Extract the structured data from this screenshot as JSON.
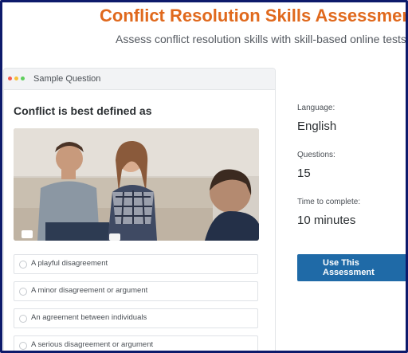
{
  "header": {
    "title": "Conflict Resolution Skills Assessment",
    "subtitle": "Assess conflict resolution skills with skill-based online tests"
  },
  "sample_card": {
    "header_label": "Sample Question",
    "question": "Conflict is best defined as",
    "options": [
      "A playful disagreement",
      "A minor disagreement or argument",
      "An agreement between individuals",
      "A serious disagreement or argument"
    ]
  },
  "details": {
    "language_label": "Language:",
    "language_value": "English",
    "questions_label": "Questions:",
    "questions_value": "15",
    "time_label": "Time to complete:",
    "time_value": "10 minutes"
  },
  "cta": {
    "label": "Use This Assessment"
  },
  "colors": {
    "title": "#e0691d",
    "button": "#1f6aa7",
    "frame": "#0d1a6b"
  }
}
